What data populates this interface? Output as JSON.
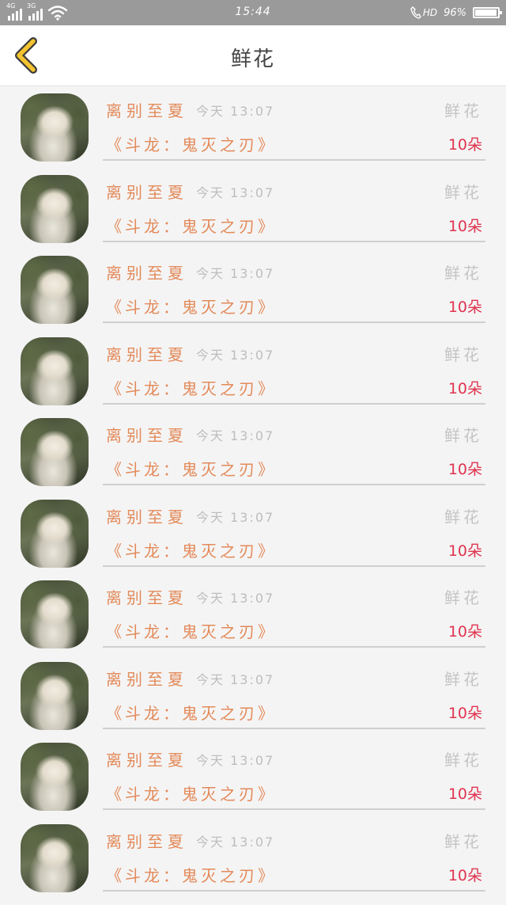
{
  "status_bar": {
    "net1": "4G",
    "net2": "3G",
    "time": "15:44",
    "hd": "HD",
    "battery": "96%",
    "battery_level": 0.96
  },
  "header": {
    "title": "鲜花",
    "back_icon": "chevron-left-icon"
  },
  "list": {
    "items": [
      {
        "sender": "离别至夏",
        "time": "今天 13:07",
        "gift": "鲜花",
        "work": "《斗龙：鬼灭之刃》",
        "qty": "10朵"
      },
      {
        "sender": "离别至夏",
        "time": "今天 13:07",
        "gift": "鲜花",
        "work": "《斗龙：鬼灭之刃》",
        "qty": "10朵"
      },
      {
        "sender": "离别至夏",
        "time": "今天 13:07",
        "gift": "鲜花",
        "work": "《斗龙：鬼灭之刃》",
        "qty": "10朵"
      },
      {
        "sender": "离别至夏",
        "time": "今天 13:07",
        "gift": "鲜花",
        "work": "《斗龙：鬼灭之刃》",
        "qty": "10朵"
      },
      {
        "sender": "离别至夏",
        "time": "今天 13:07",
        "gift": "鲜花",
        "work": "《斗龙：鬼灭之刃》",
        "qty": "10朵"
      },
      {
        "sender": "离别至夏",
        "time": "今天 13:07",
        "gift": "鲜花",
        "work": "《斗龙：鬼灭之刃》",
        "qty": "10朵"
      },
      {
        "sender": "离别至夏",
        "time": "今天 13:07",
        "gift": "鲜花",
        "work": "《斗龙：鬼灭之刃》",
        "qty": "10朵"
      },
      {
        "sender": "离别至夏",
        "time": "今天 13:07",
        "gift": "鲜花",
        "work": "《斗龙：鬼灭之刃》",
        "qty": "10朵"
      },
      {
        "sender": "离别至夏",
        "time": "今天 13:07",
        "gift": "鲜花",
        "work": "《斗龙：鬼灭之刃》",
        "qty": "10朵"
      },
      {
        "sender": "离别至夏",
        "time": "今天 13:07",
        "gift": "鲜花",
        "work": "《斗龙：鬼灭之刃》",
        "qty": "10朵"
      }
    ]
  },
  "colors": {
    "accent": "#e38a5a",
    "quantity": "#e0344f",
    "back": "#f2c230"
  }
}
